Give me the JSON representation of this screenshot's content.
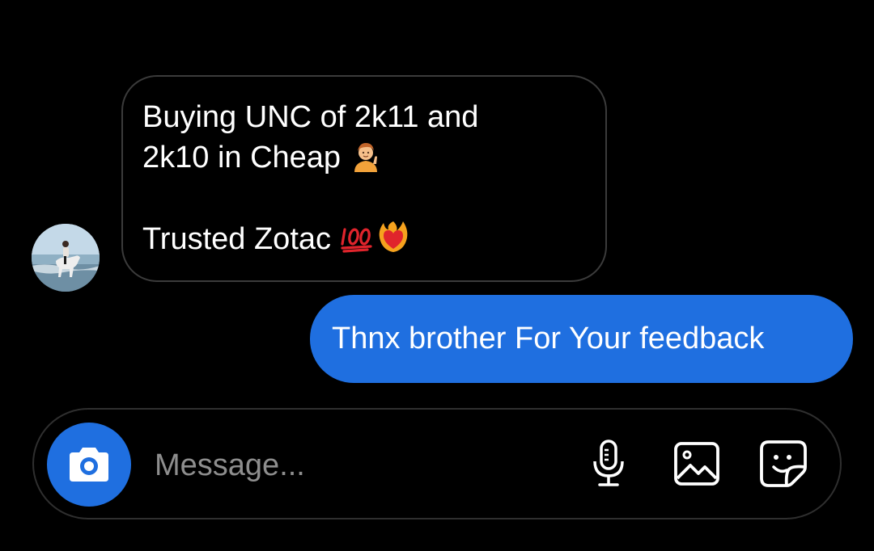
{
  "conversation": {
    "incoming": {
      "lines": [
        "Buying UNC of 2k11 and",
        "2k10 in Cheap"
      ],
      "second_paragraph": "Trusted Zotac",
      "emojis": [
        "person-tipping-hand-emoji",
        "hundred-points-emoji",
        "heart-on-fire-emoji"
      ]
    },
    "outgoing": {
      "text": "Thnx brother For Your feedback"
    }
  },
  "composer": {
    "placeholder": "Message...",
    "icons": [
      "camera-icon",
      "microphone-icon",
      "gallery-icon",
      "sticker-icon"
    ]
  },
  "colors": {
    "background": "#000000",
    "accent_blue": "#1f6fe0",
    "bubble_border": "#3b3b3b",
    "placeholder": "#8e8e8e"
  }
}
